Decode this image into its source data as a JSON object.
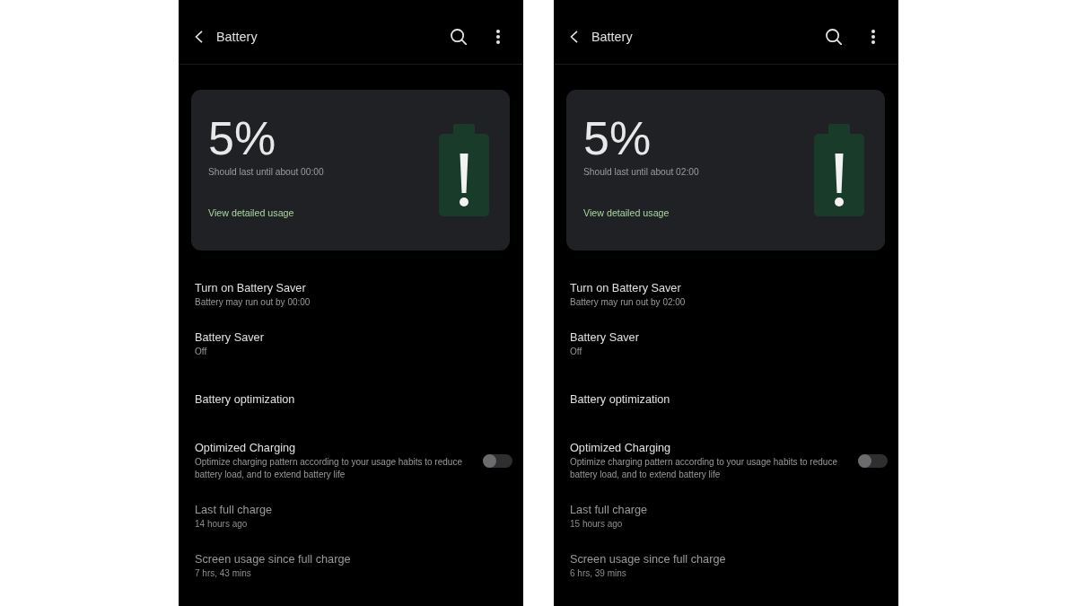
{
  "screens": [
    {
      "header": {
        "title": "Battery"
      },
      "card": {
        "percent": "5%",
        "estimate": "Should last until about 00:00",
        "link": "View detailed usage"
      },
      "items": [
        {
          "kind": "text",
          "title": "Turn on Battery Saver",
          "summary": "Battery may run out by 00:00",
          "disabled": false
        },
        {
          "kind": "text",
          "title": "Battery Saver",
          "summary": "Off",
          "disabled": false
        },
        {
          "kind": "text",
          "title": "Battery optimization",
          "disabled": false
        },
        {
          "kind": "switch",
          "title": "Optimized Charging",
          "summary": "Optimize charging pattern according to your usage habits to reduce battery load, and to extend battery life",
          "disabled": false,
          "switch": {
            "on": false
          }
        },
        {
          "kind": "text",
          "title": "Last full charge",
          "summary": "14 hours ago",
          "disabled": true
        },
        {
          "kind": "text",
          "title": "Screen usage since full charge",
          "summary": "7 hrs, 43 mins",
          "disabled": true
        }
      ]
    },
    {
      "header": {
        "title": "Battery"
      },
      "card": {
        "percent": "5%",
        "estimate": "Should last until about 02:00",
        "link": "View detailed usage"
      },
      "items": [
        {
          "kind": "text",
          "title": "Turn on Battery Saver",
          "summary": "Battery may run out by 02:00",
          "disabled": false
        },
        {
          "kind": "text",
          "title": "Battery Saver",
          "summary": "Off",
          "disabled": false
        },
        {
          "kind": "text",
          "title": "Battery optimization",
          "disabled": false
        },
        {
          "kind": "switch",
          "title": "Optimized Charging",
          "summary": "Optimize charging pattern according to your usage habits to reduce battery load, and to extend battery life",
          "disabled": false,
          "switch": {
            "on": false
          }
        },
        {
          "kind": "text",
          "title": "Last full charge",
          "summary": "15 hours ago",
          "disabled": true
        },
        {
          "kind": "text",
          "title": "Screen usage since full charge",
          "summary": "6 hrs, 39 mins",
          "disabled": true
        }
      ]
    }
  ]
}
